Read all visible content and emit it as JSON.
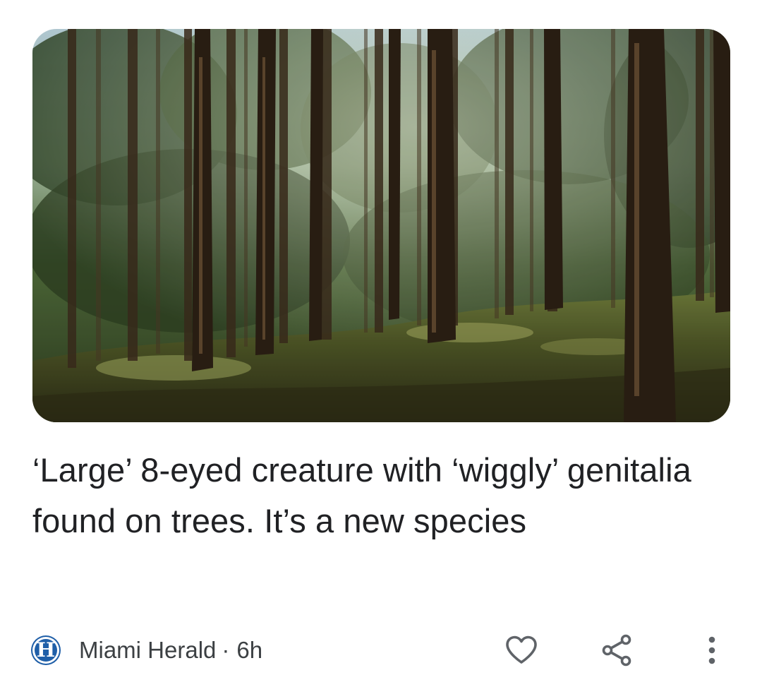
{
  "article": {
    "headline": "‘Large’ 8-eyed creature with ‘wiggly’ genitalia found on trees. It’s a new species",
    "source": {
      "logo_letter": "H",
      "name": "Miami Herald",
      "separator": "·",
      "age": "6h"
    },
    "thumbnail_icon": "forest-photo",
    "actions": {
      "like_icon": "heart-outline-icon",
      "share_icon": "share-icon",
      "more_icon": "more-vert-icon"
    }
  },
  "colors": {
    "text": "#202124",
    "meta_text": "#3c4043",
    "logo_bg": "#1f5fa8",
    "icon": "#5f6368"
  }
}
